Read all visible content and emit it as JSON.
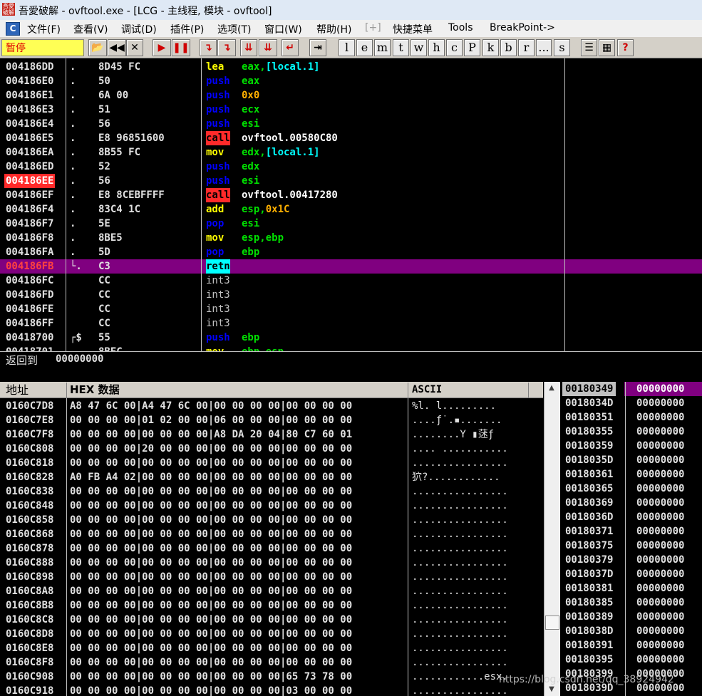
{
  "window": {
    "title": "吾愛破解 - ovftool.exe - [LCG - 主线程, 模块 - ovftool]",
    "icon_text": "吾愛破解"
  },
  "menu": {
    "items": [
      "文件(F)",
      "查看(V)",
      "调试(D)",
      "插件(P)",
      "选项(T)",
      "窗口(W)",
      "帮助(H)",
      "[+]",
      "快捷菜单",
      "Tools",
      "BreakPoint->"
    ]
  },
  "toolbar": {
    "status": "暂停",
    "buttons": [
      {
        "name": "open-icon",
        "glyph": "📂"
      },
      {
        "name": "restart-icon",
        "glyph": "◀◀"
      },
      {
        "name": "close-icon",
        "glyph": "✕"
      },
      {
        "name": "run-icon",
        "glyph": "▶"
      },
      {
        "name": "pause-icon",
        "glyph": "❚❚"
      },
      {
        "name": "step-into-icon",
        "glyph": "↴"
      },
      {
        "name": "step-over-icon",
        "glyph": "↴"
      },
      {
        "name": "trace-into-icon",
        "glyph": "⇊"
      },
      {
        "name": "trace-over-icon",
        "glyph": "⇊"
      },
      {
        "name": "execute-till-return-icon",
        "glyph": "↵"
      },
      {
        "name": "goto-icon",
        "glyph": "⇥"
      }
    ],
    "letters": [
      "l",
      "e",
      "m",
      "t",
      "w",
      "h",
      "c",
      "P",
      "k",
      "b",
      "r",
      "...",
      "s"
    ],
    "extra": [
      {
        "name": "list-icon",
        "glyph": "☰"
      },
      {
        "name": "grid-icon",
        "glyph": "▦"
      },
      {
        "name": "help-icon",
        "glyph": "?"
      }
    ]
  },
  "colors": {
    "selected_row": "#800080",
    "breakpoint": "#ff2a2a",
    "call_bg": "#ff2a2a",
    "push_pop": "#0000ff",
    "register": "#00e000",
    "memory": "#00ffff",
    "immediate": "#ffb000"
  },
  "disassembly": [
    {
      "addr": "004186DD",
      "mark": ".",
      "hex": "8D45 FC",
      "mn": "lea",
      "ops": [
        {
          "t": "eax,",
          "c": "reg"
        },
        {
          "t": "[local.1]",
          "c": "mem"
        }
      ]
    },
    {
      "addr": "004186E0",
      "mark": ".",
      "hex": "50",
      "mn": "push",
      "ops": [
        {
          "t": "eax",
          "c": "reg"
        }
      ]
    },
    {
      "addr": "004186E1",
      "mark": ".",
      "hex": "6A 00",
      "mn": "push",
      "ops": [
        {
          "t": "0x0",
          "c": "imm"
        }
      ]
    },
    {
      "addr": "004186E3",
      "mark": ".",
      "hex": "51",
      "mn": "push",
      "ops": [
        {
          "t": "ecx",
          "c": "reg"
        }
      ]
    },
    {
      "addr": "004186E4",
      "mark": ".",
      "hex": "56",
      "mn": "push",
      "ops": [
        {
          "t": "esi",
          "c": "reg"
        }
      ]
    },
    {
      "addr": "004186E5",
      "mark": ".",
      "hex": "E8 96851600",
      "mn": "call",
      "ops": [
        {
          "t": "ovftool.00580C80",
          "c": "plain"
        }
      ]
    },
    {
      "addr": "004186EA",
      "mark": ".",
      "hex": "8B55 FC",
      "mn": "mov",
      "ops": [
        {
          "t": "edx,",
          "c": "reg"
        },
        {
          "t": "[local.1]",
          "c": "mem"
        }
      ]
    },
    {
      "addr": "004186ED",
      "mark": ".",
      "hex": "52",
      "mn": "push",
      "ops": [
        {
          "t": "edx",
          "c": "reg"
        }
      ]
    },
    {
      "addr": "004186EE",
      "mark": ".",
      "hex": "56",
      "mn": "push",
      "ops": [
        {
          "t": "esi",
          "c": "reg"
        }
      ],
      "bp": true
    },
    {
      "addr": "004186EF",
      "mark": ".",
      "hex": "E8 8CEBFFFF",
      "mn": "call",
      "ops": [
        {
          "t": "ovftool.00417280",
          "c": "plain"
        }
      ]
    },
    {
      "addr": "004186F4",
      "mark": ".",
      "hex": "83C4 1C",
      "mn": "add",
      "ops": [
        {
          "t": "esp,",
          "c": "reg"
        },
        {
          "t": "0x1C",
          "c": "imm"
        }
      ]
    },
    {
      "addr": "004186F7",
      "mark": ".",
      "hex": "5E",
      "mn": "pop",
      "ops": [
        {
          "t": "esi",
          "c": "reg"
        }
      ]
    },
    {
      "addr": "004186F8",
      "mark": ".",
      "hex": "8BE5",
      "mn": "mov",
      "ops": [
        {
          "t": "esp,ebp",
          "c": "reg"
        }
      ]
    },
    {
      "addr": "004186FA",
      "mark": ".",
      "hex": "5D",
      "mn": "pop",
      "ops": [
        {
          "t": "ebp",
          "c": "reg"
        }
      ]
    },
    {
      "addr": "004186FB",
      "mark": "└.",
      "hex": "C3",
      "mn": "retn",
      "ops": [],
      "sel": true
    },
    {
      "addr": "004186FC",
      "mark": "",
      "hex": "CC",
      "mn": "int3",
      "ops": []
    },
    {
      "addr": "004186FD",
      "mark": "",
      "hex": "CC",
      "mn": "int3",
      "ops": []
    },
    {
      "addr": "004186FE",
      "mark": "",
      "hex": "CC",
      "mn": "int3",
      "ops": []
    },
    {
      "addr": "004186FF",
      "mark": "",
      "hex": "CC",
      "mn": "int3",
      "ops": []
    },
    {
      "addr": "00418700",
      "mark": "┌$",
      "hex": "55",
      "mn": "push",
      "ops": [
        {
          "t": "ebp",
          "c": "reg"
        }
      ]
    },
    {
      "addr": "00418701",
      "mark": "",
      "hex": "8BEC",
      "mn": "mov",
      "ops": [
        {
          "t": "ebp,esp",
          "c": "reg"
        }
      ]
    }
  ],
  "hint": {
    "label": "返回到",
    "value": "00000000"
  },
  "dump": {
    "headers": {
      "address": "地址",
      "hex": "HEX 数据",
      "ascii": "ASCII"
    },
    "rows": [
      {
        "addr": "0160C7D8",
        "hex": [
          "A8",
          "47",
          "6C",
          "00",
          "A4",
          "47",
          "6C",
          "00",
          "00",
          "00",
          "00",
          "00",
          "00",
          "00",
          "00",
          "00"
        ],
        "ascii": "%l. l........."
      },
      {
        "addr": "0160C7E8",
        "hex": [
          "00",
          "00",
          "00",
          "00",
          "01",
          "02",
          "00",
          "00",
          "06",
          "00",
          "00",
          "00",
          "00",
          "00",
          "00",
          "00"
        ],
        "ascii": "....ƒ˙.▪......."
      },
      {
        "addr": "0160C7F8",
        "hex": [
          "00",
          "00",
          "00",
          "00",
          "00",
          "00",
          "00",
          "00",
          "A8",
          "DA",
          "20",
          "04",
          "80",
          "C7",
          "60",
          "01"
        ],
        "ascii": "........Y  ▮蒁ƒ"
      },
      {
        "addr": "0160C808",
        "hex": [
          "00",
          "00",
          "00",
          "00",
          "20",
          "00",
          "00",
          "00",
          "00",
          "00",
          "00",
          "00",
          "00",
          "00",
          "00",
          "00"
        ],
        "ascii": ".... ..........."
      },
      {
        "addr": "0160C818",
        "hex": [
          "00",
          "00",
          "00",
          "00",
          "00",
          "00",
          "00",
          "00",
          "00",
          "00",
          "00",
          "00",
          "00",
          "00",
          "00",
          "00"
        ],
        "ascii": "................"
      },
      {
        "addr": "0160C828",
        "hex": [
          "A0",
          "FB",
          "A4",
          "02",
          "00",
          "00",
          "00",
          "00",
          "00",
          "00",
          "00",
          "00",
          "00",
          "00",
          "00",
          "00"
        ],
        "ascii": "狖?............"
      },
      {
        "addr": "0160C838",
        "hex": [
          "00",
          "00",
          "00",
          "00",
          "00",
          "00",
          "00",
          "00",
          "00",
          "00",
          "00",
          "00",
          "00",
          "00",
          "00",
          "00"
        ],
        "ascii": "................"
      },
      {
        "addr": "0160C848",
        "hex": [
          "00",
          "00",
          "00",
          "00",
          "00",
          "00",
          "00",
          "00",
          "00",
          "00",
          "00",
          "00",
          "00",
          "00",
          "00",
          "00"
        ],
        "ascii": "................"
      },
      {
        "addr": "0160C858",
        "hex": [
          "00",
          "00",
          "00",
          "00",
          "00",
          "00",
          "00",
          "00",
          "00",
          "00",
          "00",
          "00",
          "00",
          "00",
          "00",
          "00"
        ],
        "ascii": "................"
      },
      {
        "addr": "0160C868",
        "hex": [
          "00",
          "00",
          "00",
          "00",
          "00",
          "00",
          "00",
          "00",
          "00",
          "00",
          "00",
          "00",
          "00",
          "00",
          "00",
          "00"
        ],
        "ascii": "................"
      },
      {
        "addr": "0160C878",
        "hex": [
          "00",
          "00",
          "00",
          "00",
          "00",
          "00",
          "00",
          "00",
          "00",
          "00",
          "00",
          "00",
          "00",
          "00",
          "00",
          "00"
        ],
        "ascii": "................"
      },
      {
        "addr": "0160C888",
        "hex": [
          "00",
          "00",
          "00",
          "00",
          "00",
          "00",
          "00",
          "00",
          "00",
          "00",
          "00",
          "00",
          "00",
          "00",
          "00",
          "00"
        ],
        "ascii": "................"
      },
      {
        "addr": "0160C898",
        "hex": [
          "00",
          "00",
          "00",
          "00",
          "00",
          "00",
          "00",
          "00",
          "00",
          "00",
          "00",
          "00",
          "00",
          "00",
          "00",
          "00"
        ],
        "ascii": "................"
      },
      {
        "addr": "0160C8A8",
        "hex": [
          "00",
          "00",
          "00",
          "00",
          "00",
          "00",
          "00",
          "00",
          "00",
          "00",
          "00",
          "00",
          "00",
          "00",
          "00",
          "00"
        ],
        "ascii": "................"
      },
      {
        "addr": "0160C8B8",
        "hex": [
          "00",
          "00",
          "00",
          "00",
          "00",
          "00",
          "00",
          "00",
          "00",
          "00",
          "00",
          "00",
          "00",
          "00",
          "00",
          "00"
        ],
        "ascii": "................"
      },
      {
        "addr": "0160C8C8",
        "hex": [
          "00",
          "00",
          "00",
          "00",
          "00",
          "00",
          "00",
          "00",
          "00",
          "00",
          "00",
          "00",
          "00",
          "00",
          "00",
          "00"
        ],
        "ascii": "................"
      },
      {
        "addr": "0160C8D8",
        "hex": [
          "00",
          "00",
          "00",
          "00",
          "00",
          "00",
          "00",
          "00",
          "00",
          "00",
          "00",
          "00",
          "00",
          "00",
          "00",
          "00"
        ],
        "ascii": "................"
      },
      {
        "addr": "0160C8E8",
        "hex": [
          "00",
          "00",
          "00",
          "00",
          "00",
          "00",
          "00",
          "00",
          "00",
          "00",
          "00",
          "00",
          "00",
          "00",
          "00",
          "00"
        ],
        "ascii": "................"
      },
      {
        "addr": "0160C8F8",
        "hex": [
          "00",
          "00",
          "00",
          "00",
          "00",
          "00",
          "00",
          "00",
          "00",
          "00",
          "00",
          "00",
          "00",
          "00",
          "00",
          "00"
        ],
        "ascii": "................"
      },
      {
        "addr": "0160C908",
        "hex": [
          "00",
          "00",
          "00",
          "00",
          "00",
          "00",
          "00",
          "00",
          "00",
          "00",
          "00",
          "00",
          "65",
          "73",
          "78",
          "00"
        ],
        "ascii": "............esx."
      },
      {
        "addr": "0160C918",
        "hex": [
          "00",
          "00",
          "00",
          "00",
          "00",
          "00",
          "00",
          "00",
          "00",
          "00",
          "00",
          "00",
          "03",
          "00",
          "00",
          "00"
        ],
        "ascii": "................"
      }
    ]
  },
  "stack": [
    {
      "addr": "00180349",
      "val": "00000000",
      "sel": true
    },
    {
      "addr": "0018034D",
      "val": "00000000"
    },
    {
      "addr": "00180351",
      "val": "00000000"
    },
    {
      "addr": "00180355",
      "val": "00000000"
    },
    {
      "addr": "00180359",
      "val": "00000000"
    },
    {
      "addr": "0018035D",
      "val": "00000000"
    },
    {
      "addr": "00180361",
      "val": "00000000"
    },
    {
      "addr": "00180365",
      "val": "00000000"
    },
    {
      "addr": "00180369",
      "val": "00000000"
    },
    {
      "addr": "0018036D",
      "val": "00000000"
    },
    {
      "addr": "00180371",
      "val": "00000000"
    },
    {
      "addr": "00180375",
      "val": "00000000"
    },
    {
      "addr": "00180379",
      "val": "00000000"
    },
    {
      "addr": "0018037D",
      "val": "00000000"
    },
    {
      "addr": "00180381",
      "val": "00000000"
    },
    {
      "addr": "00180385",
      "val": "00000000"
    },
    {
      "addr": "00180389",
      "val": "00000000"
    },
    {
      "addr": "0018038D",
      "val": "00000000"
    },
    {
      "addr": "00180391",
      "val": "00000000"
    },
    {
      "addr": "00180395",
      "val": "00000000"
    },
    {
      "addr": "00180399",
      "val": "00000000"
    },
    {
      "addr": "0018039D",
      "val": "00000000"
    }
  ],
  "watermark": "https://blog.csdn.net/qq_38924942"
}
